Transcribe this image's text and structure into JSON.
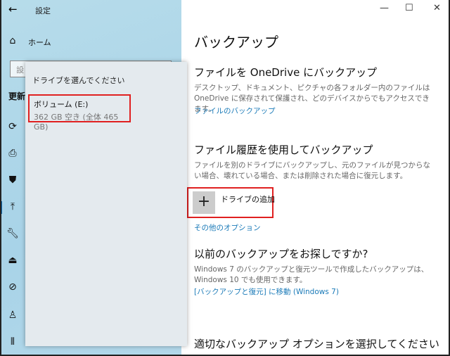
{
  "window": {
    "title": "設定",
    "back": "←",
    "minimize": "—",
    "maximize": "☐",
    "close": "✕"
  },
  "sidebar": {
    "home": "ホーム",
    "search_placeholder": "設",
    "section": "更新",
    "icons": [
      "sync-icon",
      "delivery-optimization-icon",
      "shield-icon",
      "backup-icon",
      "wrench-icon",
      "recovery-icon",
      "activation-icon",
      "find-device-icon",
      "developer-icon"
    ]
  },
  "flyout": {
    "title": "ドライブを選んでください",
    "drive_name": "ボリューム (E:)",
    "drive_info": "362 GB 空き (全体 465 GB)"
  },
  "main": {
    "title": "バックアップ",
    "onedrive": {
      "heading": "ファイルを OneDrive にバックアップ",
      "desc": "デスクトップ、ドキュメント、ピクチャの各フォルダー内のファイルは OneDrive に保存されて保護され、どのデバイスからでもアクセスできます。",
      "link": "ファイルのバックアップ"
    },
    "history": {
      "heading": "ファイル履歴を使用してバックアップ",
      "desc": "ファイルを別のドライブにバックアップし、元のファイルが見つからない場合、壊れている場合、または削除された場合に復元します。",
      "add_drive": "ドライブの追加",
      "plus": "+",
      "more": "その他のオプション"
    },
    "previous": {
      "heading": "以前のバックアップをお探しですか?",
      "desc": "Windows 7 のバックアップと復元ツールで作成したバックアップは、Windows 10 でも使用できます。",
      "link": "[バックアップと復元] に移動 (Windows 7)"
    },
    "choose": {
      "heading": "適切なバックアップ オプションを選択してください"
    }
  }
}
